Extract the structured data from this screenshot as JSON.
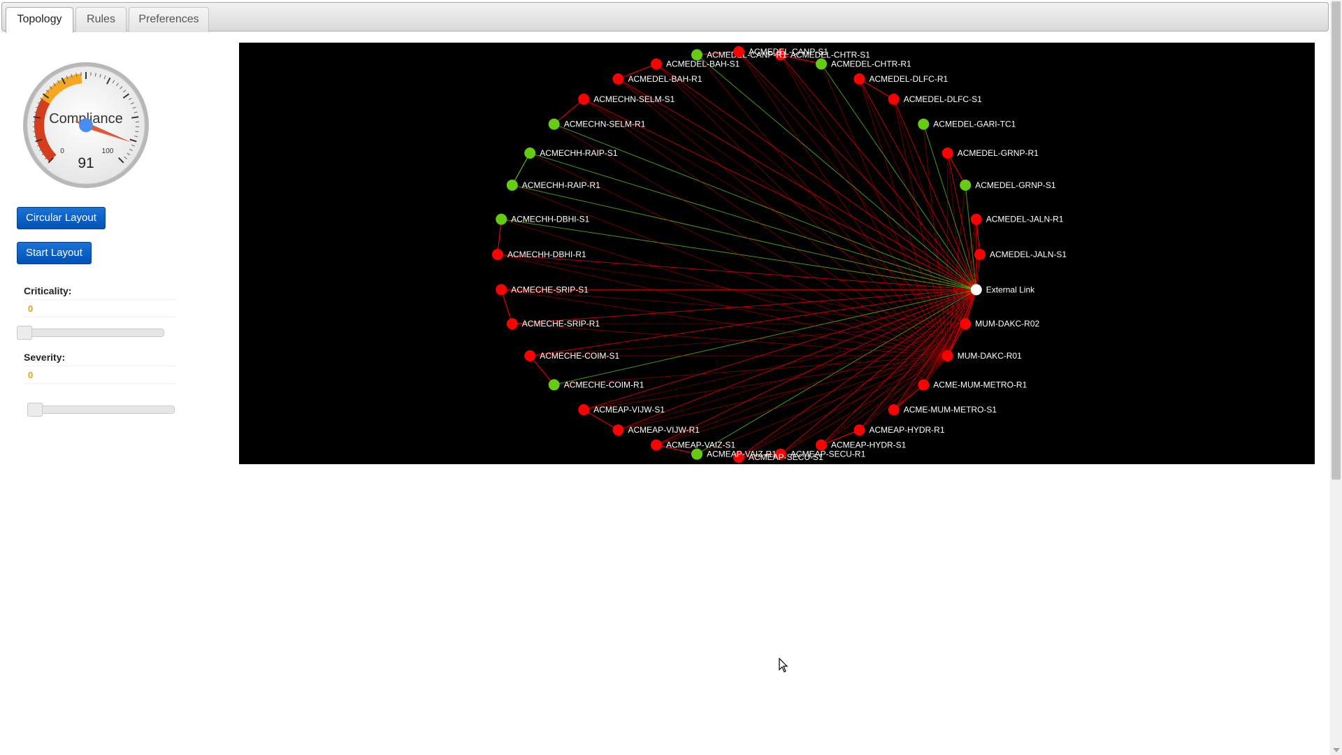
{
  "tabs": [
    {
      "label": "Topology",
      "active": true
    },
    {
      "label": "Rules",
      "active": false
    },
    {
      "label": "Preferences",
      "active": false
    }
  ],
  "gauge": {
    "title": "Compliance",
    "value": 91,
    "min_label": "0",
    "max_label": "100",
    "value_fraction": 0.91
  },
  "buttons": {
    "circular_layout": "Circular Layout",
    "start_layout": "Start Layout"
  },
  "filters": {
    "criticality": {
      "label": "Criticality:",
      "value": "0"
    },
    "severity": {
      "label": "Severity:",
      "value": "0"
    }
  },
  "colors": {
    "status_ok": "#66cc11",
    "status_bad": "#ff0000",
    "external": "#ffffff",
    "canvas": "#000000",
    "button": "#0051b5"
  },
  "topology": {
    "hub": "External Link",
    "nodes": [
      {
        "name": "ACMEDEL-CHTR-S1",
        "status": "bad"
      },
      {
        "name": "ACMEDEL-CHTR-R1",
        "status": "ok"
      },
      {
        "name": "ACMEDEL-DLFC-R1",
        "status": "bad"
      },
      {
        "name": "ACMEDEL-DLFC-S1",
        "status": "bad"
      },
      {
        "name": "ACMEDEL-GARI-TC1",
        "status": "ok"
      },
      {
        "name": "ACMEDEL-GRNP-R1",
        "status": "bad"
      },
      {
        "name": "ACMEDEL-GRNP-S1",
        "status": "ok"
      },
      {
        "name": "ACMEDEL-JALN-R1",
        "status": "bad"
      },
      {
        "name": "ACMEDEL-JALN-S1",
        "status": "bad"
      },
      {
        "name": "External Link",
        "status": "external"
      },
      {
        "name": "MUM-DAKC-R02",
        "status": "bad"
      },
      {
        "name": "MUM-DAKC-R01",
        "status": "bad"
      },
      {
        "name": "ACME-MUM-METRO-R1",
        "status": "bad"
      },
      {
        "name": "ACME-MUM-METRO-S1",
        "status": "bad"
      },
      {
        "name": "ACMEAP-HYDR-R1",
        "status": "bad"
      },
      {
        "name": "ACMEAP-HYDR-S1",
        "status": "bad"
      },
      {
        "name": "ACMEAP-SECU-R1",
        "status": "bad"
      },
      {
        "name": "ACMEAP-SECU-S1",
        "status": "bad"
      },
      {
        "name": "ACMEAP-VAIZ-R1",
        "status": "ok"
      },
      {
        "name": "ACMEAP-VAIZ-S1",
        "status": "bad"
      },
      {
        "name": "ACMEAP-VIJW-R1",
        "status": "bad"
      },
      {
        "name": "ACMEAP-VIJW-S1",
        "status": "bad"
      },
      {
        "name": "ACMECHE-COIM-R1",
        "status": "ok"
      },
      {
        "name": "ACMECHE-COIM-S1",
        "status": "bad"
      },
      {
        "name": "ACMECHE-SRIP-R1",
        "status": "bad"
      },
      {
        "name": "ACMECHE-SRIP-S1",
        "status": "bad"
      },
      {
        "name": "ACMECHH-DBHI-R1",
        "status": "bad"
      },
      {
        "name": "ACMECHH-DBHI-S1",
        "status": "ok"
      },
      {
        "name": "ACMECHH-RAIP-R1",
        "status": "ok"
      },
      {
        "name": "ACMECHH-RAIP-S1",
        "status": "ok"
      },
      {
        "name": "ACMECHN-SELM-R1",
        "status": "ok"
      },
      {
        "name": "ACMECHN-SELM-S1",
        "status": "bad"
      },
      {
        "name": "ACMEDEL-BAH-R1",
        "status": "bad"
      },
      {
        "name": "ACMEDEL-BAH-S1",
        "status": "bad"
      },
      {
        "name": "ACMEDEL-CANP-R1",
        "status": "ok"
      },
      {
        "name": "ACMEDEL-CANP-S1",
        "status": "bad"
      }
    ]
  }
}
